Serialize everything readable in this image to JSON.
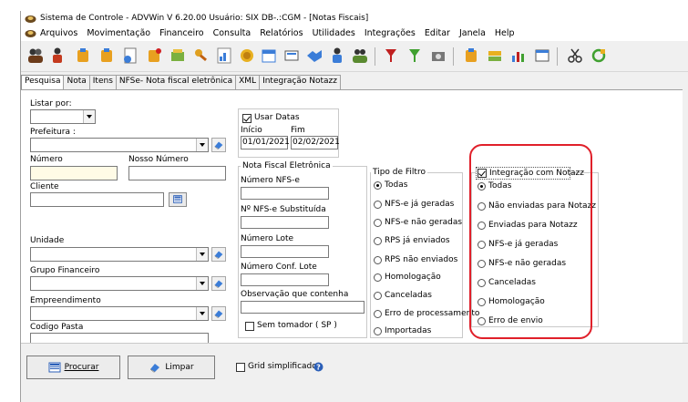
{
  "window": {
    "title": "Sistema de Controle - ADVWin  V 6.20.00 Usuário: SIX  DB-.:CGM - [Notas Fiscais]"
  },
  "menu": [
    "Arquivos",
    "Movimentação",
    "Financeiro",
    "Consulta",
    "Relatórios",
    "Utilidades",
    "Integrações",
    "Editar",
    "Janela",
    "Help"
  ],
  "tabs": [
    "Pesquisa",
    "Nota",
    "Itens",
    "NFSe- Nota fiscal eletrônica",
    "XML",
    "Integração Notazz"
  ],
  "form": {
    "listar_por": "Listar por:",
    "prefeitura": "Prefeitura :",
    "numero": "Número",
    "nosso_numero": "Nosso Número",
    "cliente": "Cliente",
    "unidade": "Unidade",
    "grupo_financeiro": "Grupo Financeiro",
    "empreendimento": "Empreendimento",
    "codigo_pasta": "Codigo Pasta"
  },
  "datas": {
    "usar_datas": "Usar Datas",
    "inicio_label": "Início",
    "fim_label": "Fim",
    "inicio": "01/01/2021",
    "fim": "02/02/2021"
  },
  "nfe_group": {
    "title": "Nota Fiscal Eletrônica",
    "numero_nfse": "Número NFS-e",
    "numero_substituida": "Nº NFS-e Substituída",
    "numero_lote": "Número Lote",
    "numero_conf_lote": "Número Conf. Lote",
    "observacao": "Observação que contenha",
    "sem_tomador": "Sem tomador ( SP )"
  },
  "tipo_filtro": {
    "title": "Tipo de Filtro",
    "options": [
      "Todas",
      "NFS-e já geradas",
      "NFS-e não geradas",
      "RPS já enviados",
      "RPS não enviados",
      "Homologação",
      "Canceladas",
      "Erro de processamento",
      "Importadas"
    ]
  },
  "notazz": {
    "title": "Integração com Notazz",
    "options": [
      "Todas",
      "Não enviadas para Notazz",
      "Enviadas para Notazz",
      "NFS-e já geradas",
      "NFS-e não geradas",
      "Canceladas",
      "Homologação",
      "Erro de envio"
    ]
  },
  "bottom": {
    "procurar": "Procurar",
    "limpar": "Limpar",
    "grid_simplificado": "Grid simplificado"
  },
  "colors": {
    "highlight": "#e0202a",
    "accent": "#2b5fb8"
  }
}
